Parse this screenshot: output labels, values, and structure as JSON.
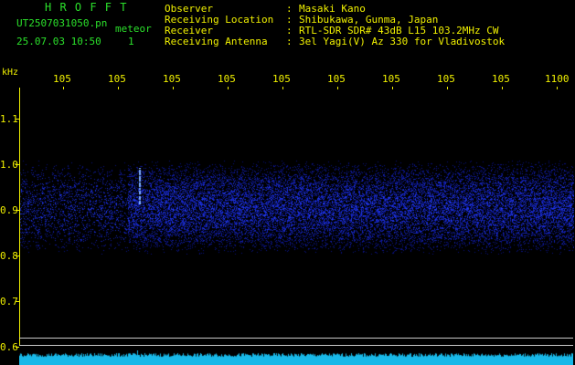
{
  "app": {
    "title": "H R O F F T",
    "file_name": "UT2507031050.pn",
    "event_type": "meteor",
    "timestamp": "25.07.03 10:50",
    "count": "1"
  },
  "station_info": [
    {
      "label": "Observer",
      "value": "Masaki Kano"
    },
    {
      "label": "Receiving Location",
      "value": "Shibukawa, Gunma, Japan"
    },
    {
      "label": "Receiver",
      "value": "RTL-SDR SDR# 43dB L15 103.2MHz CW"
    },
    {
      "label": "Receiving Antenna",
      "value": "3el Yagi(V) Az 330 for Vladivostok"
    }
  ],
  "info_separator": ":",
  "frequency_axis": {
    "unit": "kHz",
    "ticks": [
      "105",
      "105",
      "105",
      "105",
      "105",
      "105",
      "105",
      "105",
      "105",
      "1100"
    ]
  },
  "amplitude_axis": {
    "ticks": [
      "1.1",
      "1.0",
      "0.9",
      "0.8",
      "0.7",
      "0.6"
    ]
  },
  "colors": {
    "background": "#000000",
    "title": "#2be02b",
    "text": "#f0f000",
    "noise_band": "#2a3cd0",
    "meteor_trace": "#7fb0ff",
    "signal_strip": "#18b8e8",
    "reference_lines": "#c8c8c8"
  },
  "icons": {
    "meteor_event_marker": "meteor-trace-icon"
  }
}
